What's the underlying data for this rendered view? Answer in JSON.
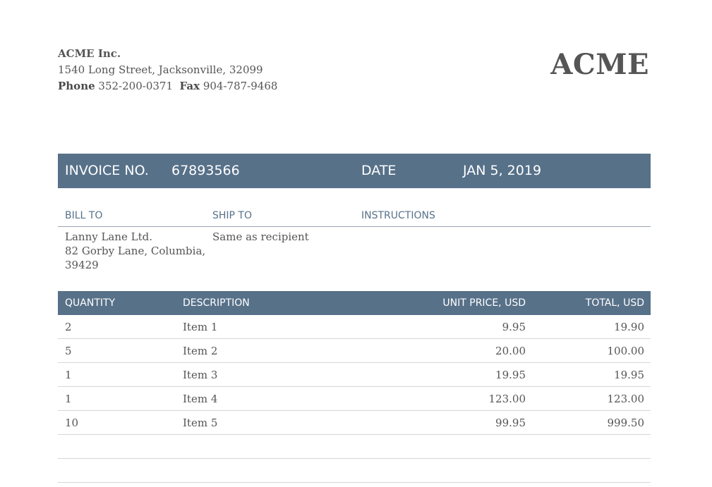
{
  "company": {
    "name": "ACME Inc.",
    "address": "1540  Long Street, Jacksonville, 32099",
    "phone_label": "Phone",
    "phone": "352-200-0371",
    "fax_label": "Fax",
    "fax": "904-787-9468",
    "logo": "ACME"
  },
  "invoice": {
    "number_label": "INVOICE NO.",
    "number": "67893566",
    "date_label": "DATE",
    "date": "JAN 5, 2019"
  },
  "addresses": {
    "bill_to_label": "BILL TO",
    "ship_to_label": "SHIP TO",
    "instructions_label": "INSTRUCTIONS",
    "bill_to_line1": "Lanny Lane Ltd.",
    "bill_to_line2": "82  Gorby Lane, Columbia,",
    "bill_to_line3": "39429",
    "ship_to": "Same as recipient",
    "instructions": ""
  },
  "items": {
    "headers": {
      "quantity": "QUANTITY",
      "description": "DESCRIPTION",
      "unit_price": "UNIT PRICE, USD",
      "total": "TOTAL, USD"
    },
    "rows": [
      {
        "quantity": "2",
        "description": "Item 1",
        "unit_price": "9.95",
        "total": "19.90"
      },
      {
        "quantity": "5",
        "description": "Item 2",
        "unit_price": "20.00",
        "total": "100.00"
      },
      {
        "quantity": "1",
        "description": "Item 3",
        "unit_price": "19.95",
        "total": "19.95"
      },
      {
        "quantity": "1",
        "description": "Item 4",
        "unit_price": "123.00",
        "total": "123.00"
      },
      {
        "quantity": "10",
        "description": "Item 5",
        "unit_price": "99.95",
        "total": "999.50"
      },
      {
        "quantity": "",
        "description": "",
        "unit_price": "",
        "total": ""
      },
      {
        "quantity": "",
        "description": "",
        "unit_price": "",
        "total": ""
      }
    ]
  },
  "colors": {
    "accent": "#577189",
    "text": "#555555"
  }
}
